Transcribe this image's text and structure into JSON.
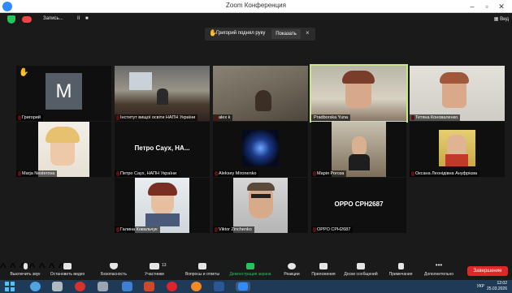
{
  "window": {
    "title": "Zoom Конференция",
    "controls": [
      "–",
      "▫",
      "✕"
    ]
  },
  "topbar": {
    "recording_label": "Запись...",
    "rec_pause": "II",
    "rec_stop": "■",
    "view_label": "Вид"
  },
  "notification": {
    "message": "Григорий поднял руку",
    "show_label": "Показать",
    "close": "×"
  },
  "participants": [
    {
      "name": "Григорий",
      "avatar_letter": "M",
      "hand_raised": true
    },
    {
      "name": "Інститут вищої освіти НАПН України"
    },
    {
      "name": "alex k"
    },
    {
      "name": "Pradborska Yuna",
      "active_speaker": true
    },
    {
      "name": "Тетяна Коноваленко"
    },
    {
      "name": "Marja Nesterova"
    },
    {
      "name": "Петро Саух, НАПН України",
      "display_text": "Петро Саух, НА..."
    },
    {
      "name": "Aleksey Mironenko"
    },
    {
      "name": "Марія Рогоза"
    },
    {
      "name": "Оксана Леонідівна Ануфрієва"
    },
    {
      "name": "Галина Ковальчук"
    },
    {
      "name": "Viktor Zinchenko"
    },
    {
      "name": "OPPO CPH2687",
      "display_text": "OPPO CPH2687"
    }
  ],
  "toolbar": {
    "items": [
      {
        "label": "Выключить звук",
        "icon": "microphone-icon"
      },
      {
        "label": "Остановить видео",
        "icon": "video-camera-icon"
      },
      {
        "label": "Безопасность",
        "icon": "shield-icon"
      },
      {
        "label": "Участники",
        "icon": "participants-icon",
        "count": "13"
      },
      {
        "label": "Вопросы и ответы",
        "icon": "qa-icon"
      },
      {
        "label": "Демонстрация экрана",
        "icon": "share-screen-icon",
        "accent": "#22c55e"
      },
      {
        "label": "Реакции",
        "icon": "reaction-icon"
      },
      {
        "label": "Приложения",
        "icon": "apps-icon"
      },
      {
        "label": "Доски сообщений",
        "icon": "whiteboard-icon"
      },
      {
        "label": "Примечания",
        "icon": "notes-icon"
      },
      {
        "label": "Дополнительно",
        "icon": "more-icon"
      }
    ],
    "end_label": "Завершение"
  },
  "taskbar": {
    "language": "УКР",
    "time": "12:02",
    "date": "25.03.2026"
  },
  "colors": {
    "end_button": "#e02828",
    "share_accent": "#22c55e",
    "speaker_outline": "#c5e68a",
    "mic_muted": "#e02828"
  }
}
